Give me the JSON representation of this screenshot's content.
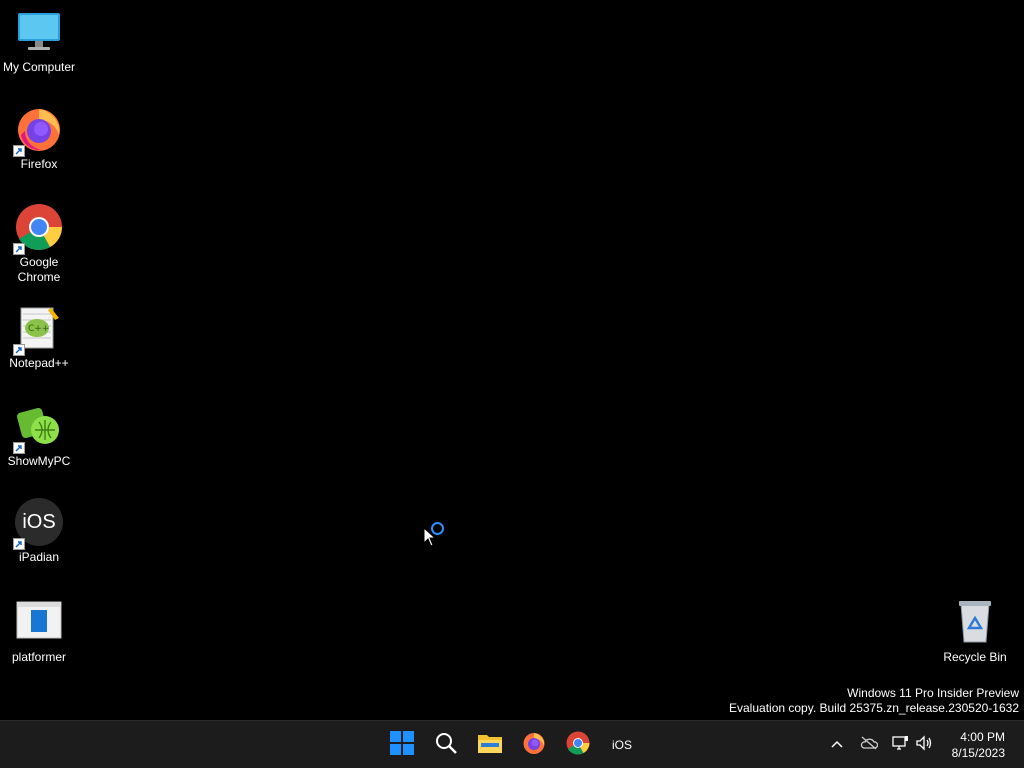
{
  "desktop": {
    "icons": [
      {
        "label": "My Computer",
        "icon": "monitor-icon"
      },
      {
        "label": "Firefox",
        "icon": "firefox-icon"
      },
      {
        "label": "Google Chrome",
        "icon": "chrome-icon"
      },
      {
        "label": "Notepad++",
        "icon": "notepadpp-icon"
      },
      {
        "label": "ShowMyPC",
        "icon": "showmypc-icon"
      },
      {
        "label": "iPadian",
        "icon": "ipadian-icon",
        "glyph": "iOS"
      },
      {
        "label": "platformer",
        "icon": "platformer-icon"
      }
    ],
    "recycle_bin": {
      "label": "Recycle Bin",
      "icon": "recycle-bin-icon"
    }
  },
  "watermark": {
    "line1": "Windows 11 Pro Insider Preview",
    "line2": "Evaluation copy. Build 25375.zn_release.230520-1632"
  },
  "taskbar": {
    "pinned": [
      {
        "name": "start",
        "icon": "windows-start-icon"
      },
      {
        "name": "search",
        "icon": "search-icon"
      },
      {
        "name": "file-explorer",
        "icon": "folder-icon"
      },
      {
        "name": "firefox",
        "icon": "firefox-icon"
      },
      {
        "name": "chrome",
        "icon": "chrome-icon"
      },
      {
        "name": "ipadian",
        "icon": "ipadian-icon",
        "glyph": "iOS"
      }
    ],
    "tray": {
      "icons": [
        "chevron-up-icon",
        "onedrive-icon",
        "network-icon",
        "volume-icon"
      ],
      "time": "4:00 PM",
      "date": "8/15/2023"
    }
  },
  "colors": {
    "desktop_bg": "#000000",
    "taskbar_bg": "#1c1c1c",
    "accent": "#0078d4"
  }
}
